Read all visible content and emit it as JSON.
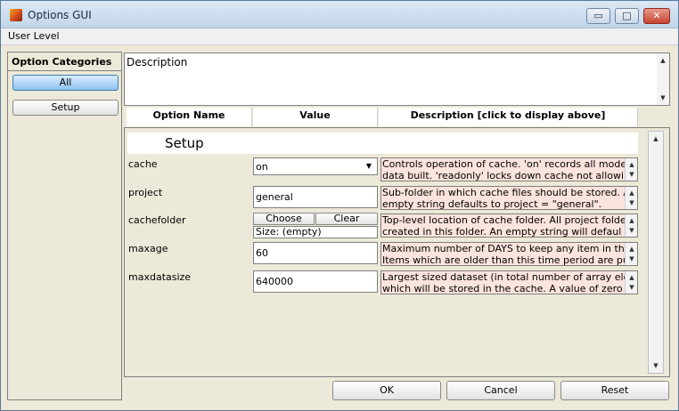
{
  "window": {
    "title": "Options GUI",
    "minimize_glyph": "▭",
    "maximize_glyph": "□",
    "close_glyph": "✕"
  },
  "menu": {
    "items": [
      "User Level"
    ]
  },
  "categories": {
    "header": "Option Categories",
    "items": [
      {
        "label": "All",
        "active": true
      },
      {
        "label": "Setup",
        "active": false
      }
    ]
  },
  "description": {
    "label": "Description"
  },
  "table": {
    "columns": [
      "Option Name",
      "Value",
      "Description [click to display above]"
    ],
    "section": "Setup",
    "rows": [
      {
        "name": "cache",
        "value": "on",
        "control": "select",
        "desc_lines": [
          "Controls operation of cache. 'on' records all models and",
          "data built. 'readonly' locks down cache not allowin ..."
        ]
      },
      {
        "name": "project",
        "value": "general",
        "control": "text",
        "desc_lines": [
          "Sub-folder in which cache files should be stored. An",
          "empty string defaults to project = \"general\"."
        ]
      },
      {
        "name": "cachefolder",
        "control": "folder",
        "choose": "Choose",
        "clear": "Clear",
        "size": "Size: (empty)",
        "desc_lines": [
          "Top-level location of cache folder. All project folders are",
          "created in this folder. An empty string will defaul ..."
        ]
      },
      {
        "name": "maxage",
        "value": "60",
        "control": "text",
        "desc_lines": [
          "Maximum number of DAYS to keep any item in the cache.",
          "Items which are older than this time period are pur ..."
        ]
      },
      {
        "name": "maxdatasize",
        "value": "640000",
        "control": "text",
        "desc_lines": [
          "Largest sized dataset (in total number of array elements)",
          "which will be stored in the cache. A value of zero  ..."
        ]
      }
    ]
  },
  "buttons": {
    "ok": "OK",
    "cancel": "Cancel",
    "reset": "Reset"
  },
  "icons": {
    "app": "matlab-logo-icon",
    "up": "▲",
    "down": "▼",
    "dropdown": "▼"
  },
  "colors": {
    "desc_bg": "#fbe4dd",
    "active_category": "#8fc2ee"
  }
}
